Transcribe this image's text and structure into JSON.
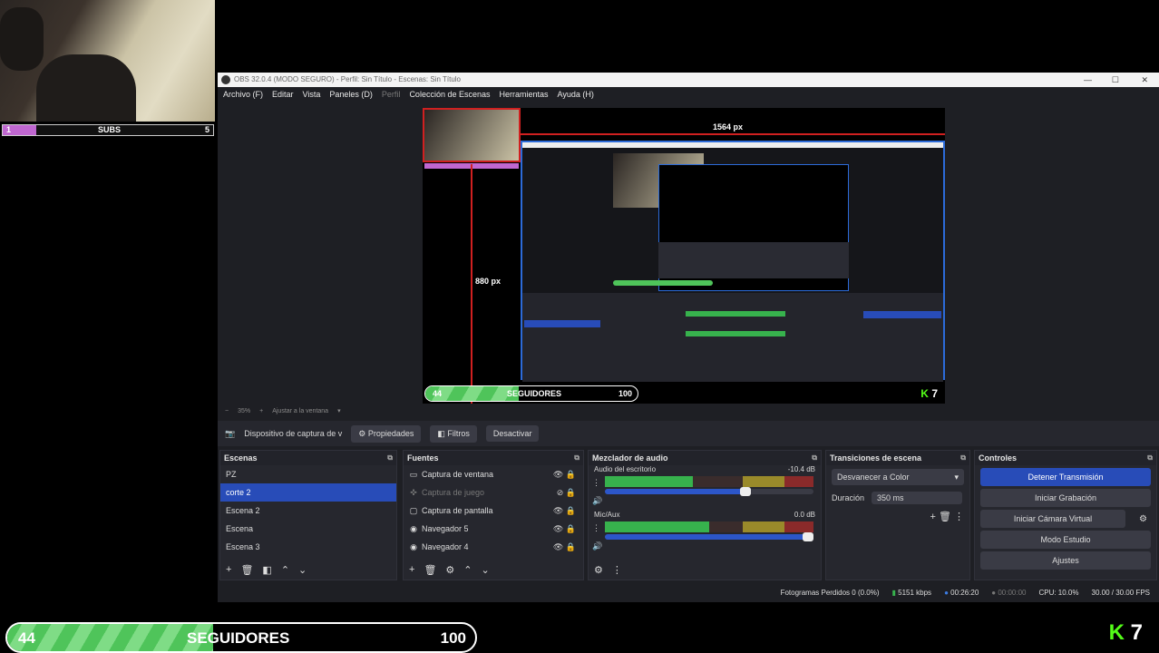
{
  "overlay": {
    "subs_label": "SUBS",
    "subs_left": "1",
    "subs_right": "5",
    "subs_progress": 0.16,
    "followers_count": "44",
    "followers_label": "SEGUIDORES",
    "followers_goal": "100",
    "followers_progress": 0.44,
    "brand_letter": "K",
    "brand_num": "7",
    "brand_color": "#53fc18"
  },
  "window": {
    "title": "OBS 32.0.4 (MODO SEGURO) - Perfil: Sin Título - Escenas: Sin Título"
  },
  "menu": [
    "Archivo (F)",
    "Editar",
    "Vista",
    "Paneles (D)",
    "Perfil",
    "Colección de Escenas",
    "Herramientas",
    "Ayuda (H)"
  ],
  "preview": {
    "width_label": "1564 px",
    "height_label": "880 px"
  },
  "zoom": {
    "value": "35%",
    "fit_label": "Ajustar a la ventana"
  },
  "source_toolbar": {
    "source_name": "Dispositivo de captura de v",
    "properties": "Propiedades",
    "filters": "Filtros",
    "deactivate": "Desactivar"
  },
  "scenes": {
    "title": "Escenas",
    "items": [
      "PZ",
      "corte 2",
      "Escena 2",
      "Escena",
      "Escena 3"
    ],
    "selected": "corte 2"
  },
  "sources": {
    "title": "Fuentes",
    "items": [
      {
        "label": "Captura de ventana",
        "icon": "window-icon",
        "dim": false
      },
      {
        "label": "Captura de juego",
        "icon": "gamepad-icon",
        "dim": true
      },
      {
        "label": "Captura de pantalla",
        "icon": "monitor-icon",
        "dim": false
      },
      {
        "label": "Navegador 5",
        "icon": "globe-icon",
        "dim": false
      },
      {
        "label": "Navegador 4",
        "icon": "globe-icon",
        "dim": false
      }
    ]
  },
  "mixer": {
    "title": "Mezclador de audio",
    "channels": [
      {
        "name": "Audio del escritorio",
        "db": "-10.4 dB",
        "level": 0.42,
        "volume": 0.7
      },
      {
        "name": "Mic/Aux",
        "db": "0.0 dB",
        "level": 0.5,
        "volume": 1.0
      }
    ],
    "ticks": [
      "-60",
      "-55",
      "-50",
      "-45",
      "-40",
      "-35",
      "-30",
      "-25",
      "-20",
      "-15",
      "-10",
      "-5",
      "0"
    ]
  },
  "transitions": {
    "title": "Transiciones de escena",
    "selected": "Desvanecer a Color",
    "duration_label": "Duración",
    "duration_value": "350 ms"
  },
  "controls": {
    "title": "Controles",
    "stop_stream": "Detener Transmisión",
    "start_record": "Iniciar Grabación",
    "virtual_cam": "Iniciar Cámara Virtual",
    "studio_mode": "Modo Estudio",
    "settings": "Ajustes"
  },
  "status": {
    "dropped": "Fotogramas Perdidos 0 (0.0%)",
    "bitrate": "5151 kbps",
    "stream_time": "00:26:20",
    "rec_time": "00:00:00",
    "cpu": "CPU: 10.0%",
    "fps": "30.00 / 30.00 FPS"
  }
}
